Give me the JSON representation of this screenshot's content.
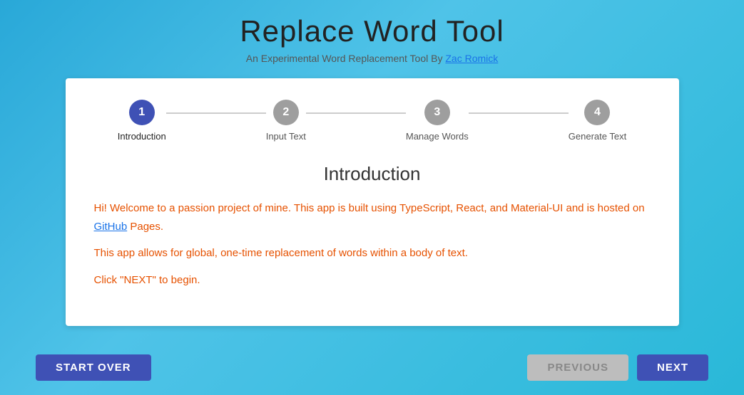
{
  "header": {
    "title": "Replace Word Tool",
    "subtitle": "An Experimental Word Replacement Tool By ",
    "author_name": "Zac Romick",
    "author_link": "#"
  },
  "stepper": {
    "steps": [
      {
        "number": "1",
        "label": "Introduction",
        "state": "active"
      },
      {
        "number": "2",
        "label": "Input Text",
        "state": "inactive"
      },
      {
        "number": "3",
        "label": "Manage Words",
        "state": "inactive"
      },
      {
        "number": "4",
        "label": "Generate Text",
        "state": "inactive"
      }
    ]
  },
  "content": {
    "title": "Introduction",
    "paragraphs": [
      {
        "id": "p1",
        "text_before": "Hi! Welcome to a passion project of mine. This app is built using TypeScript, React, and Material-UI and is hosted on ",
        "link_text": "GitHub",
        "text_after": " Pages."
      },
      {
        "id": "p2",
        "full_text": "This app allows for global, one-time replacement of words within a body of text."
      },
      {
        "id": "p3",
        "full_text": "Click \"NEXT\" to begin."
      }
    ]
  },
  "footer": {
    "start_over_label": "START OVER",
    "previous_label": "PREVIOUS",
    "next_label": "NEXT"
  }
}
